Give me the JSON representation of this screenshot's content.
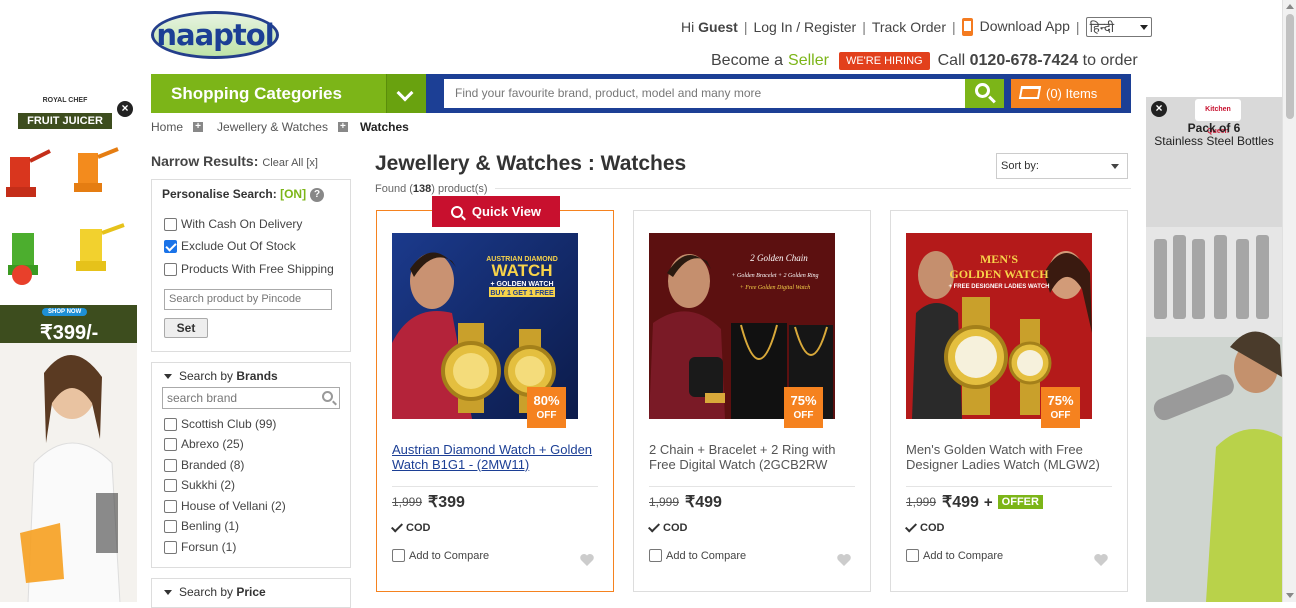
{
  "brand": {
    "logo_text": "naaptol"
  },
  "topbar": {
    "greeting_prefix": "Hi ",
    "greeting_user": "Guest",
    "login": "Log In / Register",
    "track": "Track Order",
    "download": "Download App",
    "language": "हिन्दी"
  },
  "seller": {
    "prefix": "Become a",
    "link": "Seller",
    "hiring": "WE'RE HIRING",
    "call_prefix": "Call ",
    "phone": "0120-678-7424",
    "call_suffix": " to order"
  },
  "nav": {
    "categories": "Shopping Categories",
    "search_placeholder": "Find your favourite brand, product, model and many more",
    "cart": "(0) Items"
  },
  "breadcrumb": [
    "Home",
    "Jewellery & Watches",
    "Watches"
  ],
  "sidebar": {
    "narrow": "Narrow Results:",
    "clear": "Clear All [x]",
    "personalise": "Personalise Search:",
    "on": "[ON]",
    "help": "?",
    "options": [
      {
        "label": "With Cash On Delivery",
        "checked": false
      },
      {
        "label": "Exclude Out Of Stock",
        "checked": true
      },
      {
        "label": "Products With Free Shipping",
        "checked": false
      }
    ],
    "pincode_placeholder": "Search product by Pincode",
    "set": "Set",
    "brands_prefix": "Search by ",
    "brands_title": "Brands",
    "brand_placeholder": "search brand",
    "brands": [
      "Scottish Club (99)",
      "Abrexo (25)",
      "Branded (8)",
      "Sukkhi (2)",
      "House of Vellani (2)",
      "Benling (1)",
      "Forsun (1)"
    ],
    "price_prefix": "Search by ",
    "price_title": "Price"
  },
  "main": {
    "title": "Jewellery & Watches : Watches",
    "found_prefix": "Found (",
    "found_count": "138",
    "found_suffix": ") product(s)",
    "sort": "Sort by:",
    "quick_view": "Quick View"
  },
  "products": [
    {
      "name": "Austrian Diamond Watch + Golden Watch B1G1 - (2MW11)",
      "mrp": "1,999",
      "price": "₹399",
      "discount": "80%",
      "off": "OFF",
      "cod": "COD",
      "compare": "Add to Compare",
      "offer": null,
      "banner": [
        "AUSTRIAN DIAMOND",
        "WATCH",
        "+ GOLDEN WATCH",
        "BUY 1 GET 1 FREE"
      ]
    },
    {
      "name": "2 Chain + Bracelet + 2 Ring with Free Digital Watch (2GCB2RW",
      "mrp": "1,999",
      "price": "₹499",
      "discount": "75%",
      "off": "OFF",
      "cod": "COD",
      "compare": "Add to Compare",
      "offer": null,
      "banner": [
        "2 Golden Chain",
        "+ Golden Bracelet + 2 Golden Ring",
        "+ Free Golden Digital Watch"
      ]
    },
    {
      "name": "Men's Golden Watch with Free Designer Ladies Watch (MLGW2)",
      "mrp": "1,999",
      "price": "₹499",
      "discount": "75%",
      "off": "OFF",
      "cod": "COD",
      "compare": "Add to Compare",
      "offer": "OFFER",
      "plus": "+",
      "banner": [
        "MEN'S",
        "GOLDEN WATCH",
        "+ FREE DESIGNER LADIES WATCH"
      ]
    }
  ],
  "ads": {
    "left_brand": "ROYAL CHEF",
    "left_title": "FRUIT JUICER",
    "left_cta": "SHOP NOW",
    "left_price": "₹399/-",
    "right_brand": "Kitchen Queen",
    "right_title": "Pack of 6",
    "right_sub": "Stainless Steel Bottles",
    "close": "×"
  },
  "colors": {
    "green": "#7cb518",
    "navy": "#1c3f95",
    "orange": "#f5821f",
    "red": "#c8102e"
  }
}
